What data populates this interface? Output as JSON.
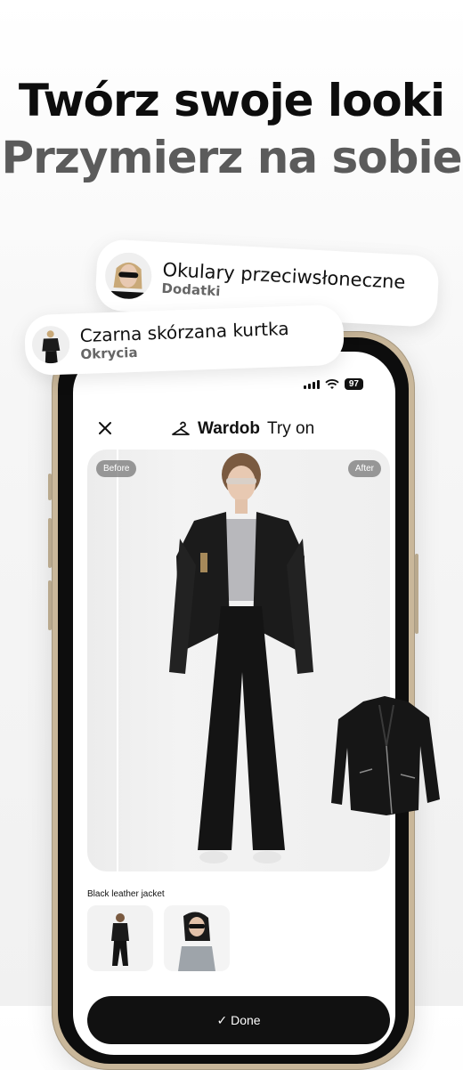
{
  "headline": {
    "line1": "Twórz swoje looki",
    "line2": "Przymierz na sobie"
  },
  "cards": [
    {
      "title": "Okulary przeciwsłoneczne",
      "subtitle": "Dodatki",
      "icon": "sunglasses-woman-avatar"
    },
    {
      "title": "Czarna skórzana kurtka",
      "subtitle": "Okrycia",
      "icon": "jacket-outfit-avatar"
    }
  ],
  "status_bar": {
    "battery": "97"
  },
  "app_bar": {
    "brand": "Wardob",
    "mode": "Try on"
  },
  "photo": {
    "before_label": "Before",
    "after_label": "After"
  },
  "selected_item": {
    "label": "Black leather jacket"
  },
  "thumbnails": [
    {
      "icon": "outfit-full-body-thumbnail"
    },
    {
      "icon": "outfit-sunglasses-thumbnail"
    }
  ],
  "done_button": {
    "label": "Done"
  },
  "colors": {
    "accent": "#111111",
    "background": "#f4f4f4",
    "phone_frame": "#c9b79a"
  }
}
